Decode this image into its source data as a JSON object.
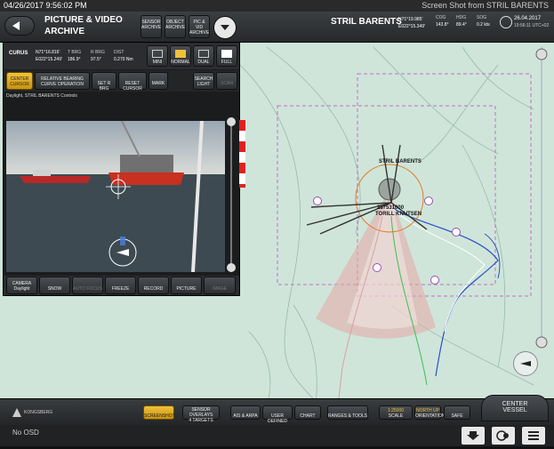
{
  "window": {
    "datetime": "04/26/2017 9:56:02 PM",
    "title": "Screen Shot from STRIL BARENTS"
  },
  "archive": {
    "title_line1": "PICTURE & VIDEO",
    "title_line2": "ARCHIVE",
    "buttons": [
      {
        "line1": "SENSOR",
        "line2": "ARCHIVE"
      },
      {
        "line1": "OBJECT",
        "line2": "ARCHIVE"
      },
      {
        "line1": "PIC & VID",
        "line2": "ARCHIVE"
      }
    ]
  },
  "vessel": {
    "name": "STRIL BARENTS",
    "position_lat": "N71°19.985'",
    "position_lon": "E022°15.349'",
    "cog_label": "COG",
    "cog_value": "143.8°",
    "hdg_label": "HDG",
    "hdg_value": "89.4°",
    "sog_label": "SOG",
    "sog_value": "0.2 kts",
    "date": "26.04.2017",
    "time": "19:56:11 UTC+02"
  },
  "cursor": {
    "label": "CURUS",
    "lat": "N71°16.816'",
    "lon": "E022°15.249'",
    "t_brg_label": "T BRG",
    "t_brg_value": "186.9°",
    "r_brg_label": "R BRG",
    "r_brg_value": "97.5°",
    "dist_label": "DIST",
    "dist_value": "0.270 Nm"
  },
  "view_modes": [
    {
      "label": "MINI",
      "active": false
    },
    {
      "label": "NORMAL",
      "active": true
    },
    {
      "label": "DUAL",
      "active": false
    },
    {
      "label": "FULL",
      "active": false
    }
  ],
  "camera_controls": {
    "center_cursor_1": "CENTER",
    "center_cursor_2": "CURSOR",
    "relative_bearing_1": "RELATIVE BEARING",
    "relative_bearing_2": "CURVE OPERATION",
    "set_r_brg": "SET R BRG",
    "reset_cursor": "RESET CURSOR",
    "mark": "MARK",
    "search_light_1": "SEARCH",
    "search_light_2": "LIGHT",
    "scan": "SCAN",
    "panel_title": "Daylight, STRIL BARENTS Controls"
  },
  "camera_toolbar": [
    {
      "label": "CAMERA",
      "sub": "Daylight"
    },
    {
      "label": "SNOW",
      "sub": ""
    },
    {
      "label": "AUTO FOCUS",
      "sub": ""
    },
    {
      "label": "FREEZE",
      "sub": ""
    },
    {
      "label": "RECORD",
      "sub": ""
    },
    {
      "label": "PICTURE",
      "sub": ""
    },
    {
      "label": "IMAGE",
      "sub": ""
    }
  ],
  "map_labels": {
    "vessel_label": "STRIL BARENTS",
    "target_label_1": "257531000",
    "target_label_2": "TORILL KNUTSEN"
  },
  "bottom_bar": {
    "logo": "KONGSBERG",
    "screenshot": "SCREENSHOT",
    "sensor_overlays_1": "SENSOR",
    "sensor_overlays_2": "OVERLAYS",
    "sensor_overlays_3": "4 TARGETS",
    "ais_arpa": "AIS & ARPA",
    "user_defined": "USER DEFINED",
    "chart": "CHART",
    "ranges_tools": "RANGES & TOOLS",
    "scale_value": "1:25000",
    "scale_label": "SCALE",
    "north_up": "NORTH UP",
    "orientation": "ORIENTATION",
    "safe": "SAFE",
    "center_vessel_1": "CENTER",
    "center_vessel_2": "VESSEL"
  },
  "status": {
    "osd": "No OSD"
  },
  "colors": {
    "accent_yellow": "#f0c23a",
    "map_bg": "#cfe5da",
    "camera_indicator_red": "#e02020"
  }
}
